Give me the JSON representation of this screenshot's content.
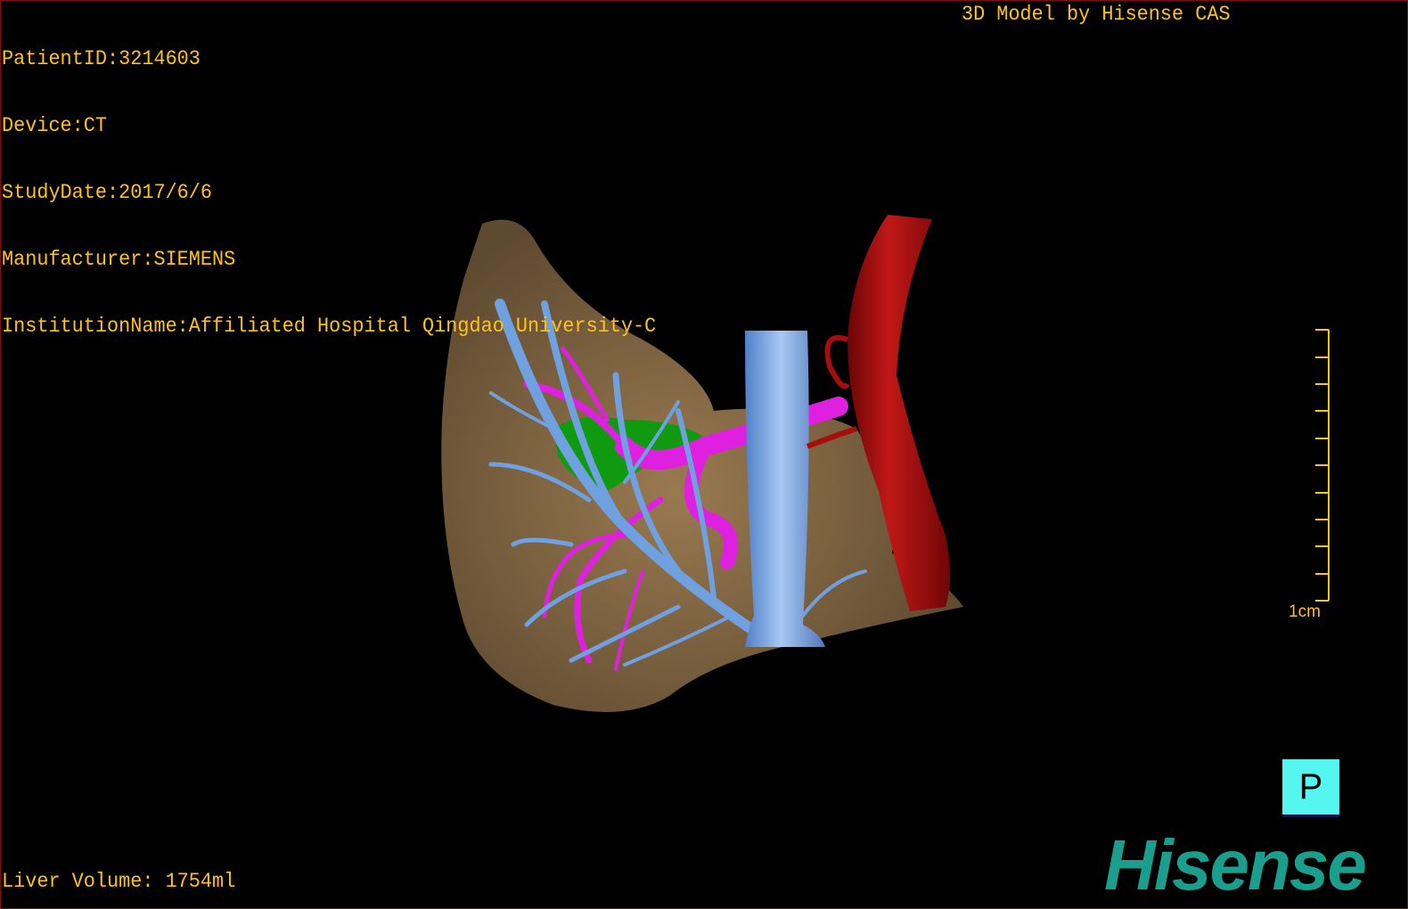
{
  "overlay": {
    "patient_id": "PatientID:3214603",
    "device": "Device:CT",
    "study_date": "StudyDate:2017/6/6",
    "manufacturer": "Manufacturer:SIEMENS",
    "institution": "InstitutionName:Affiliated Hospital Qingdao University-C",
    "model_credit": "3D Model by Hisense CAS",
    "liver_volume": "Liver Volume: 1754ml"
  },
  "scale_bar": {
    "label": "1cm",
    "ticks": 11
  },
  "orientation_marker": {
    "label": "P"
  },
  "logo": {
    "text": "Hisense"
  },
  "colors": {
    "overlay_text": "#ffc21a",
    "liver": "#8a6c45",
    "hepatic_veins": "#6fa0e0",
    "portal_vein": "#e020e0",
    "gallbladder": "#109a10",
    "aorta": "#a80c0c",
    "orientation_box": "#55f5f0",
    "logo": "#1a9f8f"
  }
}
